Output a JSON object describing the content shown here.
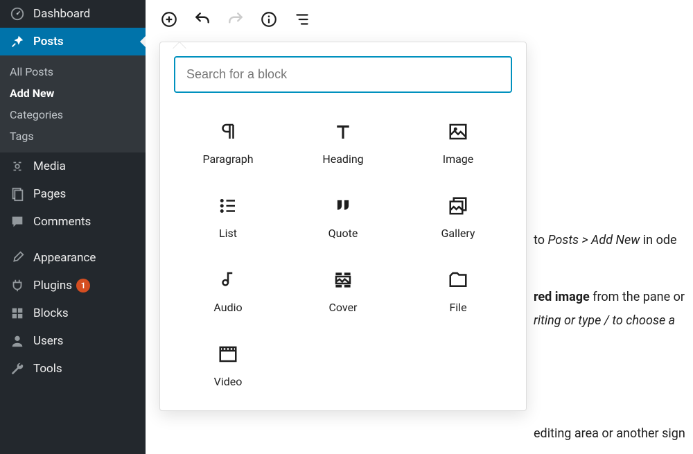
{
  "sidebar": {
    "dashboard": "Dashboard",
    "posts": "Posts",
    "posts_sub": {
      "all": "All Posts",
      "add_new": "Add New",
      "categories": "Categories",
      "tags": "Tags"
    },
    "media": "Media",
    "pages": "Pages",
    "comments": "Comments",
    "appearance": "Appearance",
    "plugins": "Plugins",
    "plugins_badge": "1",
    "blocks": "Blocks",
    "users": "Users",
    "tools": "Tools"
  },
  "toolbar": {
    "add": "Add block",
    "undo": "Undo",
    "redo": "Redo",
    "info": "Content structure",
    "outline": "Block navigation"
  },
  "inserter": {
    "search_placeholder": "Search for a block",
    "blocks": {
      "paragraph": "Paragraph",
      "heading": "Heading",
      "image": "Image",
      "list": "List",
      "quote": "Quote",
      "gallery": "Gallery",
      "audio": "Audio",
      "cover": "Cover",
      "file": "File",
      "video": "Video"
    }
  },
  "bg": {
    "line1_a": " to ",
    "line1_em": "Posts > Add New",
    "line1_b": " in ode",
    "line2_b": "red image",
    "line2_a": " from the pane or",
    "line3": "riting or type / to choose a",
    "line4": "editing area or another sign"
  }
}
